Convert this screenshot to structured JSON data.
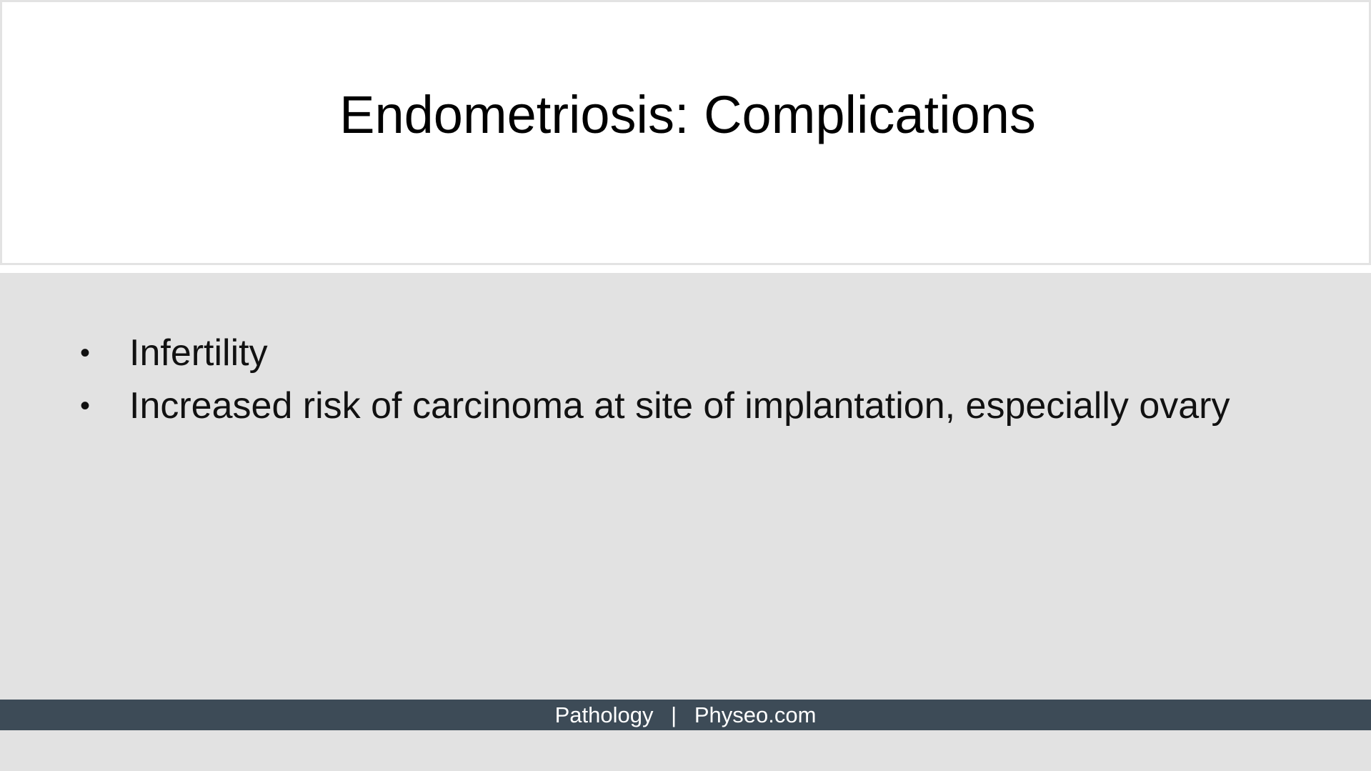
{
  "slide": {
    "title": "Endometriosis: Complications",
    "bullets": [
      "Infertility",
      "Increased risk of carcinoma at site of implantation, especially ovary"
    ],
    "bullet_symbol": "•"
  },
  "footer": {
    "left": "Pathology",
    "separator": "|",
    "right": "Physeo.com"
  },
  "colors": {
    "title_background": "#ffffff",
    "content_background": "#e2e2e2",
    "footer_background": "#3d4b57",
    "footer_text": "#ffffff"
  }
}
